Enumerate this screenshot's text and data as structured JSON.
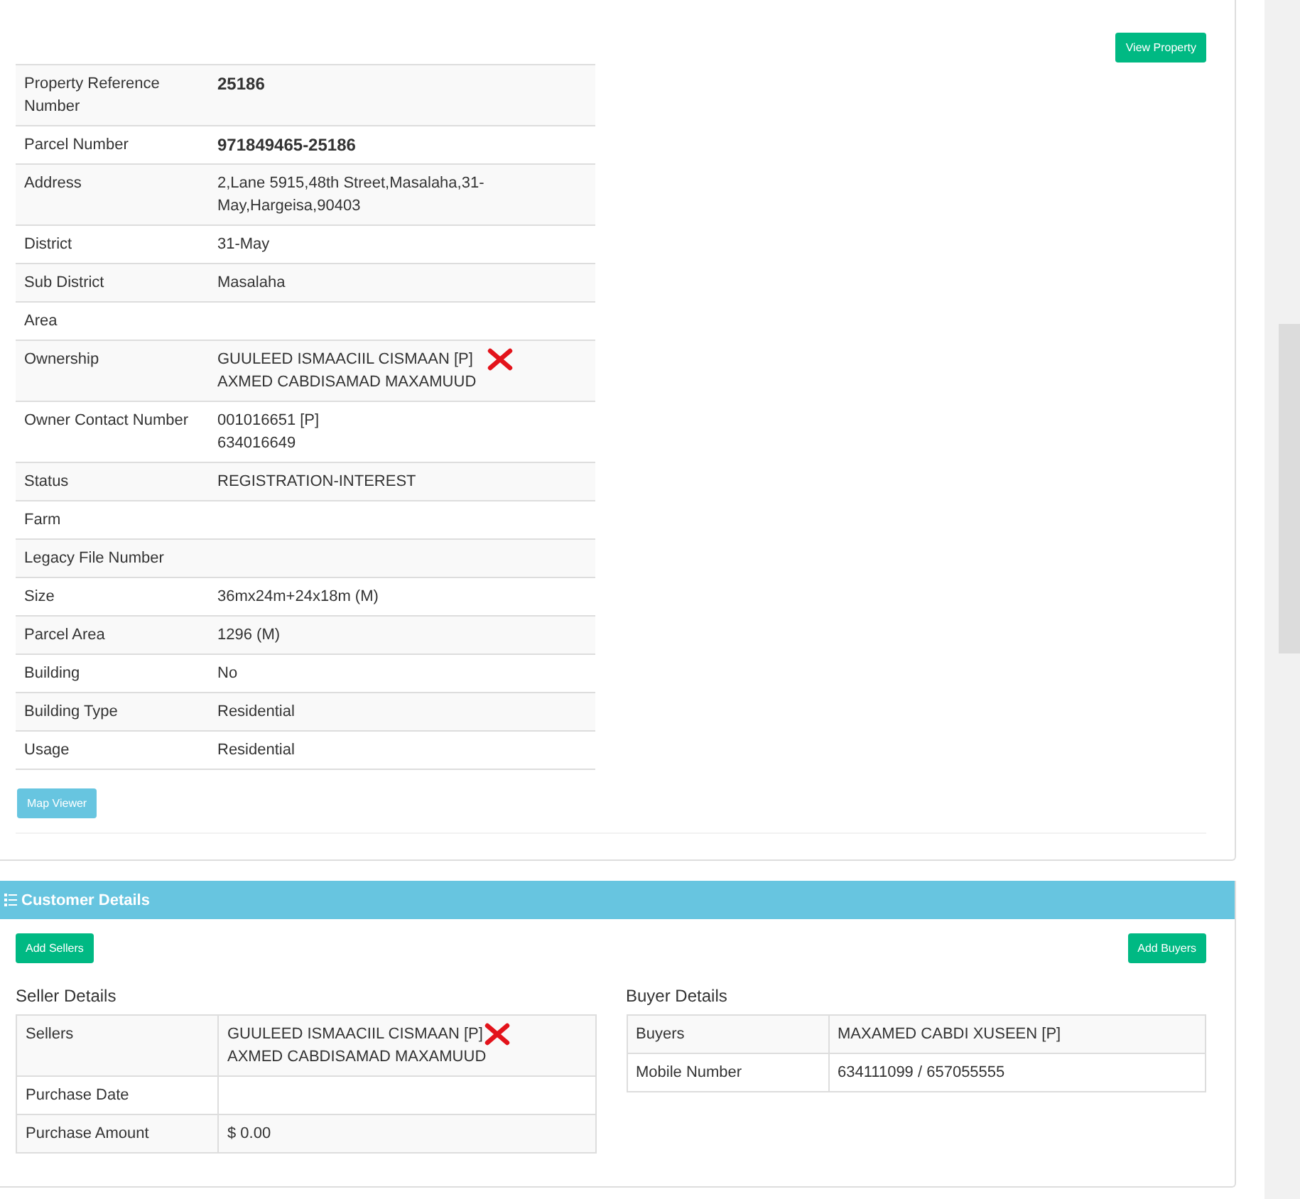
{
  "property_panel": {
    "view_button": "View Property",
    "rows": [
      {
        "label": "Property Reference Number",
        "bold": true,
        "lines": [
          {
            "text": "25186",
            "crossed": false
          }
        ]
      },
      {
        "label": "Parcel Number",
        "bold": true,
        "lines": [
          {
            "text": "971849465-25186",
            "crossed": false
          }
        ]
      },
      {
        "label": "Address",
        "bold": false,
        "lines": [
          {
            "text": "2,Lane 5915,48th Street,Masalaha,31-May,Hargeisa,90403",
            "crossed": false
          }
        ]
      },
      {
        "label": "District",
        "bold": false,
        "lines": [
          {
            "text": "31-May",
            "crossed": false
          }
        ]
      },
      {
        "label": "Sub District",
        "bold": false,
        "lines": [
          {
            "text": "Masalaha",
            "crossed": false
          }
        ]
      },
      {
        "label": "Area"
      },
      {
        "label": "Ownership",
        "bold": false,
        "lines": [
          {
            "text": "GUULEED ISMAACIIL CISMAAN [P]",
            "crossed": true
          },
          {
            "text": "AXMED CABDISAMAD MAXAMUUD",
            "crossed": false
          }
        ]
      },
      {
        "label": "Owner Contact Number",
        "bold": false,
        "lines": [
          {
            "text": "001016651 [P]",
            "crossed": false
          },
          {
            "text": "634016649",
            "crossed": false
          }
        ]
      },
      {
        "label": "Status",
        "bold": false,
        "lines": [
          {
            "text": "REGISTRATION-INTEREST",
            "crossed": false
          }
        ]
      },
      {
        "label": "Farm"
      },
      {
        "label": "Legacy File Number"
      },
      {
        "label": "Size",
        "bold": false,
        "lines": [
          {
            "text": "36mx24m+24x18m (M)",
            "crossed": false
          }
        ]
      },
      {
        "label": "Parcel Area",
        "bold": false,
        "lines": [
          {
            "text": "1296 (M)",
            "crossed": false
          }
        ]
      },
      {
        "label": "Building",
        "bold": false,
        "lines": [
          {
            "text": "No",
            "crossed": false
          }
        ]
      },
      {
        "label": "Building Type",
        "bold": false,
        "lines": [
          {
            "text": "Residential",
            "crossed": false
          }
        ]
      },
      {
        "label": "Usage",
        "bold": false,
        "lines": [
          {
            "text": "Residential",
            "crossed": false
          }
        ]
      }
    ],
    "map_button": "Map Viewer"
  },
  "customer_details": {
    "title": "Customer Details",
    "add_sellers": "Add Sellers",
    "add_buyers": "Add Buyers",
    "seller": {
      "heading": "Seller Details",
      "rows": [
        {
          "label": "Sellers",
          "lines": [
            {
              "text": "GUULEED ISMAACIIL CISMAAN [P]",
              "crossed": true
            },
            {
              "text": "AXMED CABDISAMAD MAXAMUUD",
              "crossed": false
            }
          ]
        },
        {
          "label": "Purchase Date"
        },
        {
          "label": "Purchase Amount",
          "lines": [
            {
              "text": "$ 0.00",
              "crossed": false
            }
          ]
        }
      ]
    },
    "buyer": {
      "heading": "Buyer Details",
      "rows": [
        {
          "label": "Buyers",
          "lines": [
            {
              "text": "MAXAMED CABDI XUSEEN [P]",
              "crossed": false
            }
          ]
        },
        {
          "label": "Mobile Number",
          "lines": [
            {
              "text": "634111099 / 657055555",
              "crossed": false
            }
          ]
        }
      ]
    }
  }
}
